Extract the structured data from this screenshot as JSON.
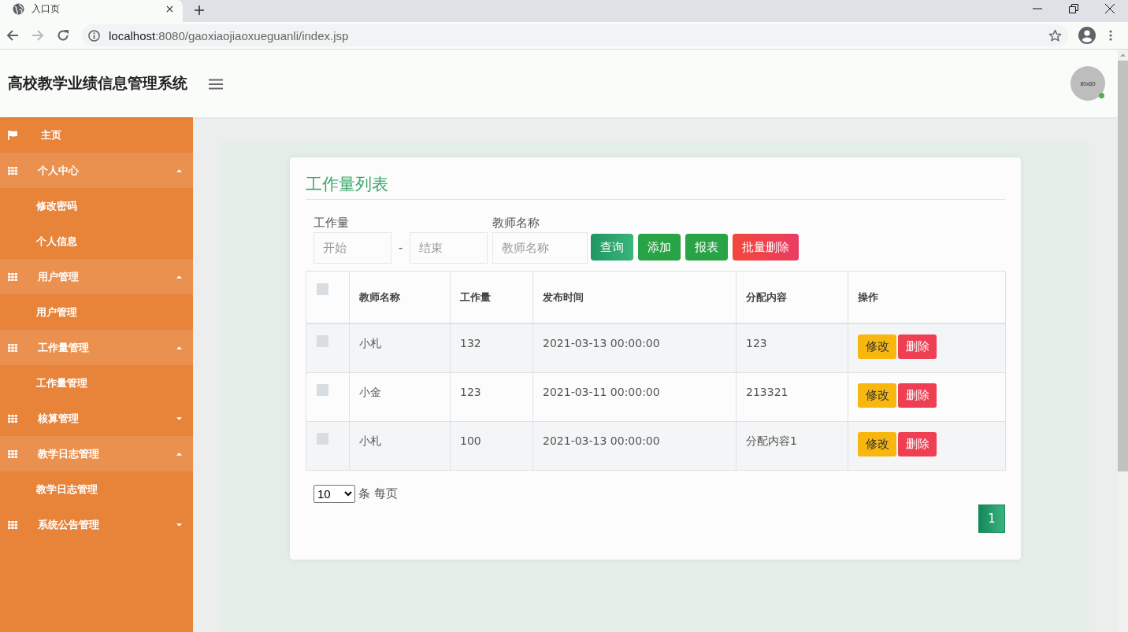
{
  "browser": {
    "tab": {
      "title": "入口页"
    },
    "url": {
      "host": "localhost",
      "path": ":8080/gaoxiaojiaoxueguanli/index.jsp"
    },
    "forward_disabled": true
  },
  "header": {
    "title": "高校教学业绩信息管理系统",
    "avatar": {
      "label": "80x80",
      "online": true
    }
  },
  "sidebar": {
    "items": [
      {
        "kind": "link",
        "label": "主页"
      },
      {
        "kind": "group",
        "label": "个人中心",
        "expanded": true,
        "children": [
          {
            "label": "修改密码"
          },
          {
            "label": "个人信息"
          }
        ]
      },
      {
        "kind": "group",
        "label": "用户管理",
        "expanded": true,
        "children": [
          {
            "label": "用户管理"
          }
        ]
      },
      {
        "kind": "group",
        "label": "工作量管理",
        "expanded": true,
        "children": [
          {
            "label": "工作量管理"
          }
        ]
      },
      {
        "kind": "group",
        "label": "核算管理",
        "expanded": false
      },
      {
        "kind": "group",
        "label": "教学日志管理",
        "expanded": true,
        "children": [
          {
            "label": "教学日志管理"
          }
        ]
      },
      {
        "kind": "group",
        "label": "系统公告管理",
        "expanded": false
      }
    ]
  },
  "card": {
    "title": "工作量列表",
    "filters": {
      "workload": {
        "label": "工作量",
        "start_placeholder": "开始",
        "separator": "-",
        "end_placeholder": "结束"
      },
      "teacher": {
        "label": "教师名称",
        "placeholder": "教师名称"
      }
    },
    "buttons": [
      {
        "kind": "search",
        "label": "查询"
      },
      {
        "kind": "add",
        "label": "添加"
      },
      {
        "kind": "report",
        "label": "报表"
      },
      {
        "kind": "danger",
        "label": "批量删除"
      }
    ],
    "table": {
      "header_checked": false,
      "columns": [
        "教师名称",
        "工作量",
        "发布时间",
        "分配内容",
        "操作"
      ],
      "rows": [
        {
          "checked": false,
          "cells": [
            "小札",
            "132",
            "2021-03-13 00:00:00",
            "123"
          ],
          "actions": [
            {
              "kind": "edit",
              "label": "修改"
            },
            {
              "kind": "delete",
              "label": "删除"
            }
          ]
        },
        {
          "checked": false,
          "cells": [
            "小金",
            "123",
            "2021-03-11 00:00:00",
            "213321"
          ],
          "actions": [
            {
              "kind": "edit",
              "label": "修改"
            },
            {
              "kind": "delete",
              "label": "删除"
            }
          ]
        },
        {
          "checked": false,
          "cells": [
            "小札",
            "100",
            "2021-03-13 00:00:00",
            "分配内容1"
          ],
          "actions": [
            {
              "kind": "edit",
              "label": "修改"
            },
            {
              "kind": "delete",
              "label": "删除"
            }
          ]
        }
      ]
    },
    "page_size": {
      "value": "10",
      "suffix": "条 每页"
    },
    "pagination": [
      {
        "label": "1",
        "selected": true
      }
    ]
  }
}
